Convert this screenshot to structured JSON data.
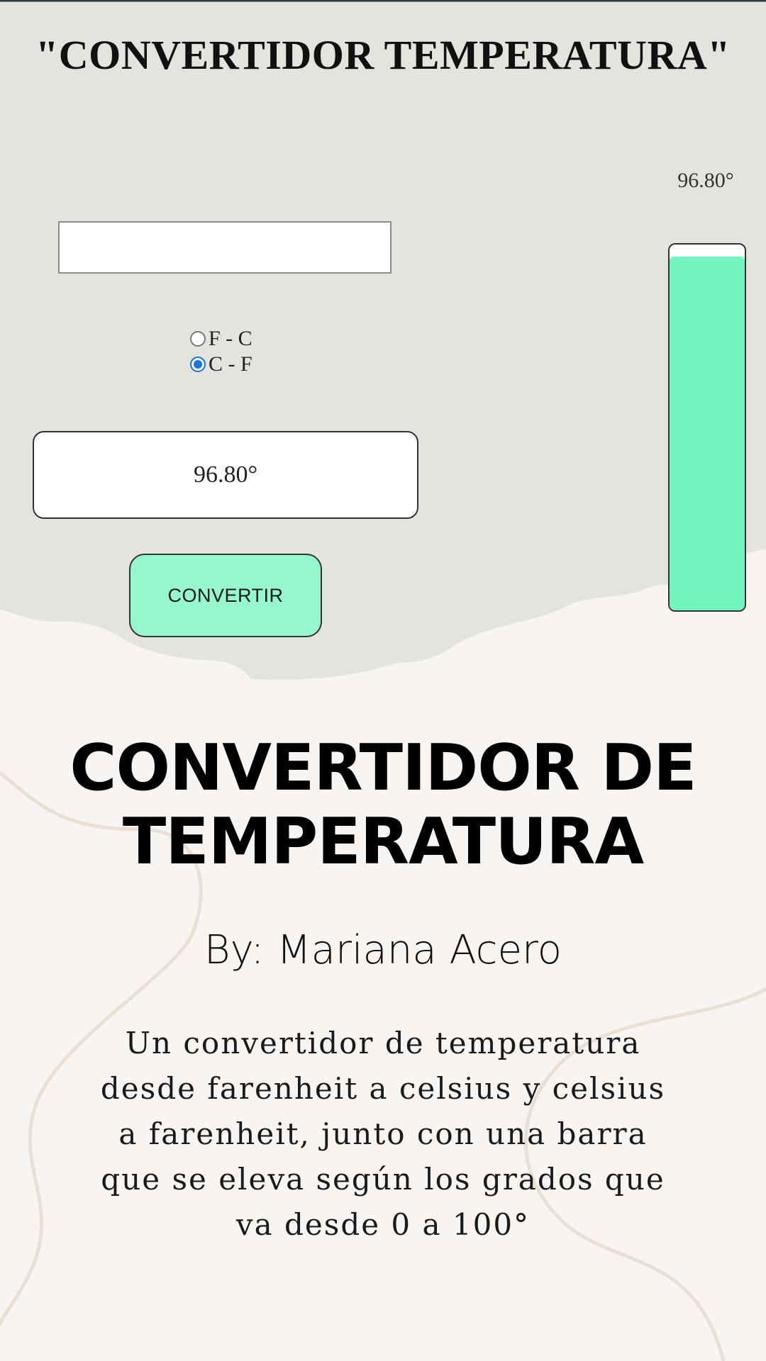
{
  "app": {
    "title": "\"CONVERTIDOR TEMPERATURA\"",
    "input_value": "",
    "radio_options": [
      {
        "label": "F - C",
        "checked": false
      },
      {
        "label": "C - F",
        "checked": true
      }
    ],
    "result": "96.80°",
    "convert_label": "CONVERTIR",
    "thermometer": {
      "label": "96.80°",
      "level": 0.968,
      "fill_color": "#72f5bf"
    },
    "button_color": "#96f7cf",
    "panel_color": "#e4e4df"
  },
  "promo": {
    "heading_line1": "CONVERTIDOR DE",
    "heading_line2": "TEMPERATURA",
    "byline": "By: Mariana Acero",
    "description": "Un convertidor de temperatura desde farenheit a celsius y celsius a farenheit, junto con una barra que se eleva según los grados que va desde 0 a 100°",
    "background_color": "#f7f4f1",
    "decor_line_color": "#e8ddd2"
  }
}
